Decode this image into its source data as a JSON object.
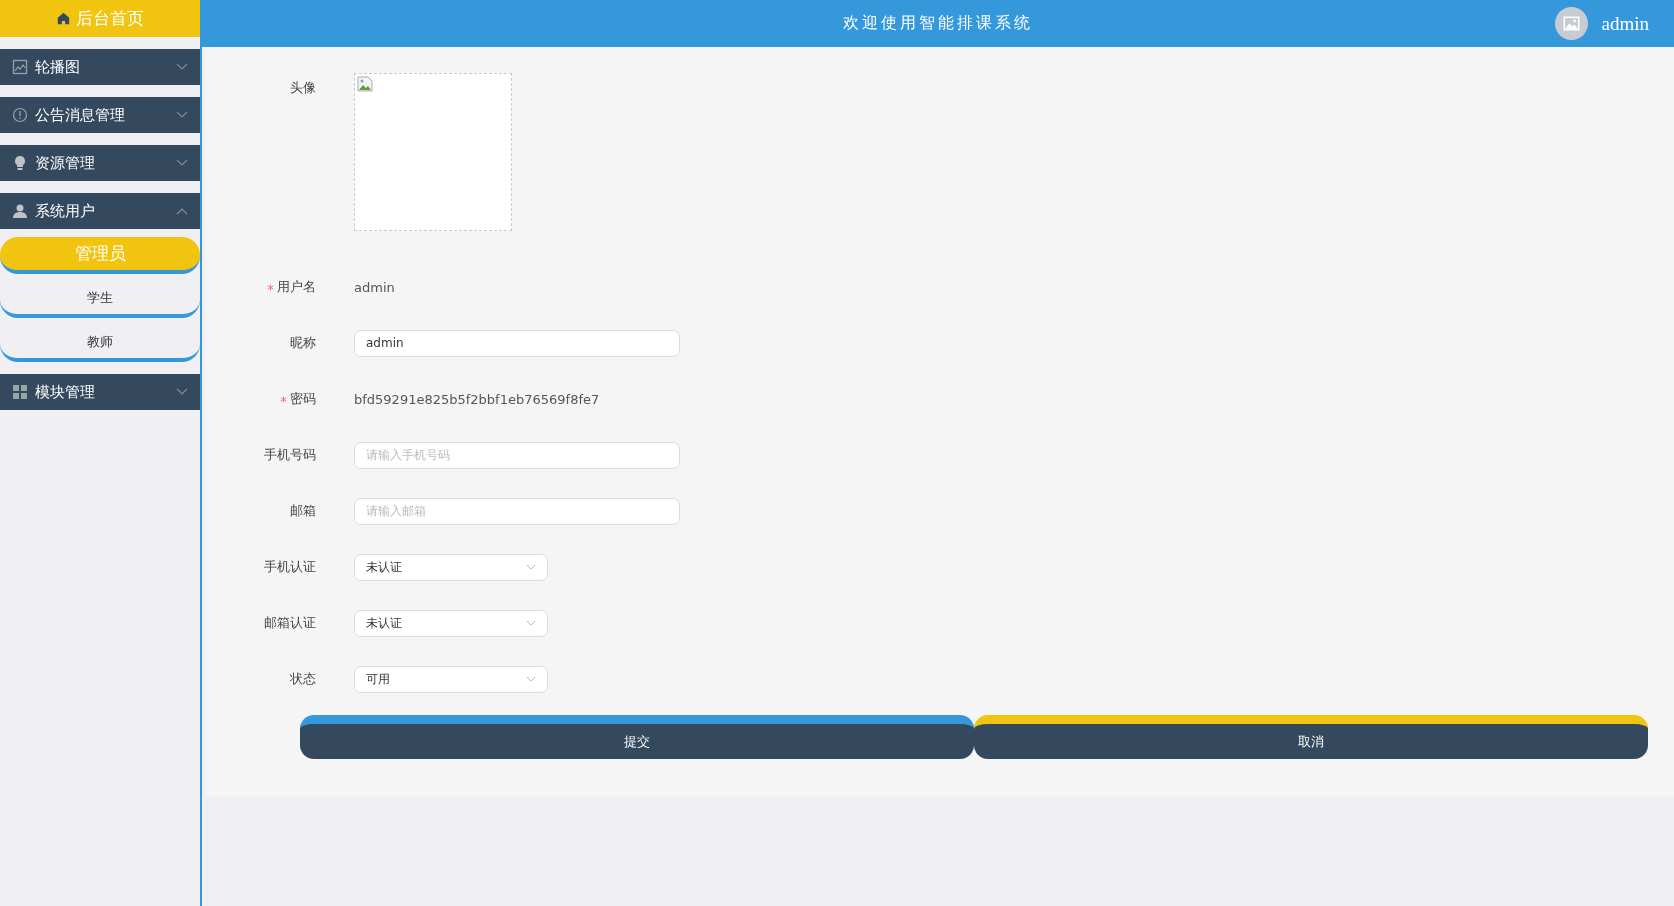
{
  "header": {
    "home_link": "后台首页",
    "title": "欢迎使用智能排课系统",
    "user": "admin"
  },
  "sidebar": {
    "items": [
      {
        "label": "轮播图",
        "expanded": false
      },
      {
        "label": "公告消息管理",
        "expanded": false
      },
      {
        "label": "资源管理",
        "expanded": false
      },
      {
        "label": "系统用户",
        "expanded": true,
        "children": [
          {
            "label": "管理员",
            "selected": true
          },
          {
            "label": "学生",
            "selected": false
          },
          {
            "label": "教师",
            "selected": false
          }
        ]
      },
      {
        "label": "模块管理",
        "expanded": false
      }
    ]
  },
  "form": {
    "fields": [
      {
        "kind": "avatar",
        "label": "头像",
        "required": false
      },
      {
        "kind": "text",
        "label": "用户名",
        "required": true,
        "value": "admin"
      },
      {
        "kind": "input",
        "label": "昵称",
        "required": false,
        "value": "admin"
      },
      {
        "kind": "text",
        "label": "密码",
        "required": true,
        "value": "bfd59291e825b5f2bbf1eb76569f8fe7"
      },
      {
        "kind": "input",
        "label": "手机号码",
        "required": false,
        "placeholder": "请输入手机号码"
      },
      {
        "kind": "input",
        "label": "邮箱",
        "required": false,
        "placeholder": "请输入邮箱"
      },
      {
        "kind": "select",
        "label": "手机认证",
        "required": false,
        "value": "未认证"
      },
      {
        "kind": "select",
        "label": "邮箱认证",
        "required": false,
        "value": "未认证"
      },
      {
        "kind": "select",
        "label": "状态",
        "required": false,
        "value": "可用"
      }
    ]
  },
  "buttons": [
    {
      "kind": "submit",
      "label": "提交"
    },
    {
      "kind": "cancel",
      "label": "取消"
    }
  ]
}
